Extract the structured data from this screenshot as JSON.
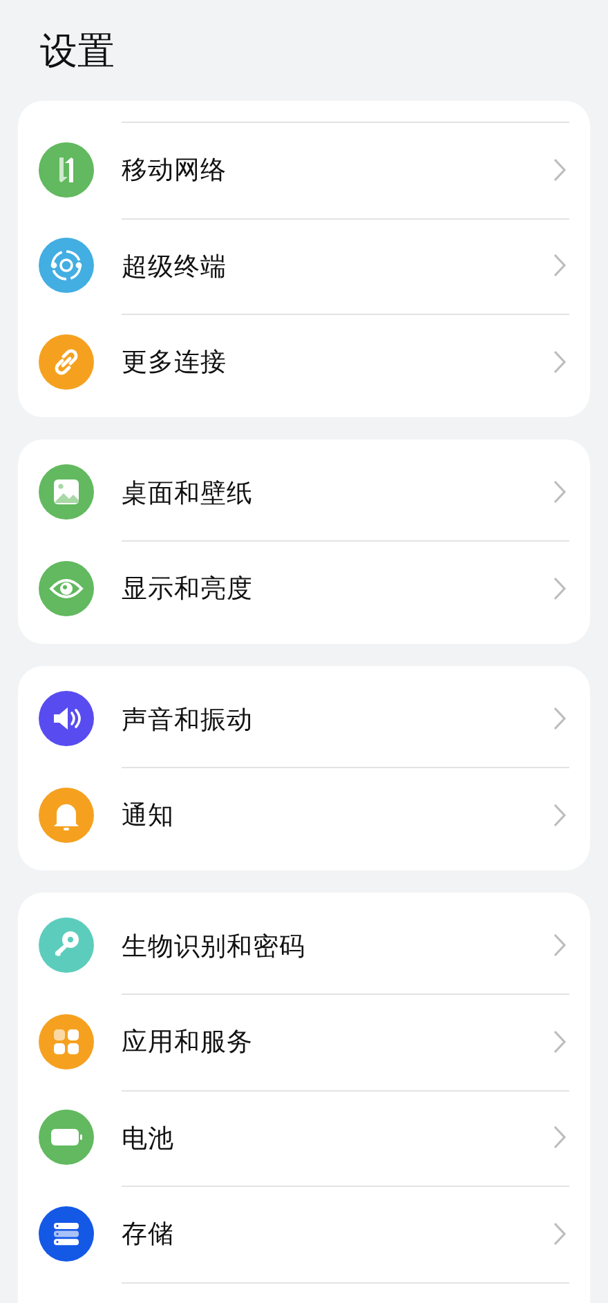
{
  "title": "设置",
  "groups": [
    {
      "continued": true,
      "items": [
        {
          "label": "移动网络",
          "kind": "arrows",
          "color": "#62b95f"
        },
        {
          "label": "超级终端",
          "kind": "orbit",
          "color": "#42aee2"
        },
        {
          "label": "更多连接",
          "kind": "link",
          "color": "#f5a11f"
        }
      ]
    },
    {
      "continued": false,
      "items": [
        {
          "label": "桌面和壁纸",
          "kind": "image",
          "color": "#62b95f"
        },
        {
          "label": "显示和亮度",
          "kind": "eye",
          "color": "#62b95f"
        }
      ]
    },
    {
      "continued": false,
      "items": [
        {
          "label": "声音和振动",
          "kind": "speaker",
          "color": "#584cf0"
        },
        {
          "label": "通知",
          "kind": "bell",
          "color": "#f5a11f"
        }
      ]
    },
    {
      "continued": false,
      "continues_below": true,
      "items": [
        {
          "label": "生物识别和密码",
          "kind": "key",
          "color": "#5ccdbd"
        },
        {
          "label": "应用和服务",
          "kind": "apps",
          "color": "#f5a11f"
        },
        {
          "label": "电池",
          "kind": "battery",
          "color": "#62b95f"
        },
        {
          "label": "存储",
          "kind": "storage",
          "color": "#1458e6"
        }
      ]
    }
  ]
}
